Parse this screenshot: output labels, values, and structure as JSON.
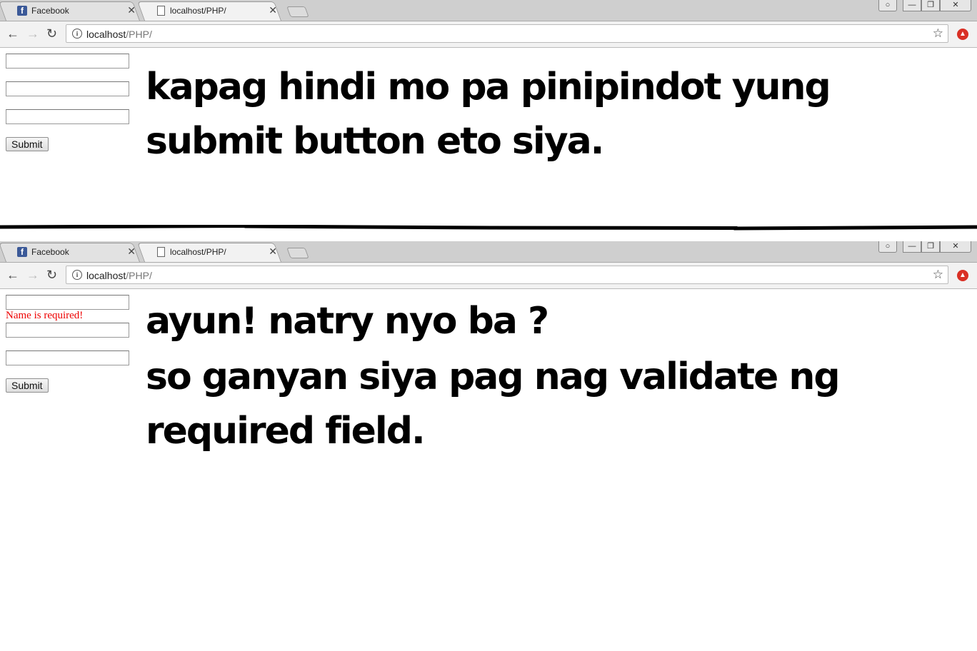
{
  "screen1": {
    "tabs": [
      {
        "title": "Facebook",
        "icon": "facebook-icon"
      },
      {
        "title": "localhost/PHP/",
        "icon": "page-icon"
      }
    ],
    "url_host": "localhost",
    "url_path": "/PHP/",
    "submit_label": "Submit",
    "note_lines": [
      "kapag hindi mo pa pinipindot yung",
      "submit button eto siya."
    ]
  },
  "screen2": {
    "tabs": [
      {
        "title": "Facebook",
        "icon": "facebook-icon"
      },
      {
        "title": "localhost/PHP/",
        "icon": "page-icon"
      }
    ],
    "url_host": "localhost",
    "url_path": "/PHP/",
    "error_message": "Name is required!",
    "submit_label": "Submit",
    "note_lines": [
      "ayun! natry nyo ba ?",
      "so ganyan siya pag nag validate ng",
      "required field."
    ]
  },
  "glyphs": {
    "close": "✕",
    "back": "←",
    "forward": "→",
    "reload": "↻",
    "star": "☆",
    "info": "i",
    "fb": "f"
  },
  "colors": {
    "error": "#e00000",
    "facebook": "#3b5998",
    "extension": "#d93025"
  }
}
